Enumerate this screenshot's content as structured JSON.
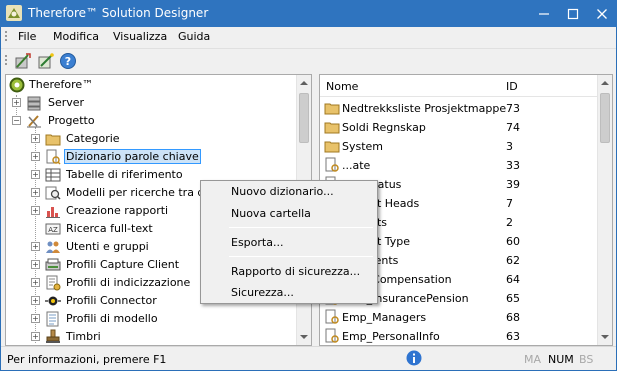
{
  "window": {
    "title": "Therefore™ Solution Designer"
  },
  "menubar": {
    "items": [
      "File",
      "Modifica",
      "Visualizza",
      "Guida"
    ]
  },
  "toolbar": {
    "buttons": [
      "designer-icon",
      "wizard-icon",
      "help-icon"
    ]
  },
  "tree": {
    "root": "Therefore™",
    "server": "Server",
    "project": "Progetto",
    "children": [
      "Categorie",
      "Dizionario parole chiave",
      "Tabelle di riferimento",
      "Modelli per ricerche tra d",
      "Creazione rapporti",
      "Ricerca full-text",
      "Utenti e gruppi",
      "Profili Capture Client",
      "Profili di indicizzazione",
      "Profili Connector",
      "Profili di modello",
      "Timbri"
    ],
    "selected_index": 1
  },
  "list": {
    "columns": {
      "name": "Nome",
      "id": "ID"
    },
    "rows": [
      {
        "name": "Nedtrekksliste Prosjektmappe",
        "id": "73",
        "icon": "folder"
      },
      {
        "name": "Soldi Regnskap",
        "id": "74",
        "icon": "folder"
      },
      {
        "name": "System",
        "id": "3",
        "icon": "folder"
      },
      {
        "name": "...ate",
        "id": "33",
        "icon": "dictionary"
      },
      {
        "name": "...ct Status",
        "id": "39",
        "icon": "dictionary"
      },
      {
        "name": "...ment Heads",
        "id": "7",
        "icon": "dictionary"
      },
      {
        "name": "...ments",
        "id": "2",
        "icon": "dictionary"
      },
      {
        "name": "...ment Type",
        "id": "60",
        "icon": "dictionary"
      },
      {
        "name": "...ccidents",
        "id": "62",
        "icon": "dictionary"
      },
      {
        "name": "Emp_Compensation",
        "id": "64",
        "icon": "dictionary"
      },
      {
        "name": "Emp_InsurancePension",
        "id": "65",
        "icon": "dictionary"
      },
      {
        "name": "Emp_Managers",
        "id": "68",
        "icon": "dictionary"
      },
      {
        "name": "Emp_PersonalInfo",
        "id": "63",
        "icon": "dictionary"
      }
    ]
  },
  "context_menu": {
    "items": [
      "Nuovo dizionario...",
      "Nuova cartella",
      "Esporta...",
      "Rapporto di sicurezza...",
      "Sicurezza..."
    ]
  },
  "statusbar": {
    "text": "Per informazioni, premere F1",
    "indicators": [
      {
        "label": "MA",
        "active": false
      },
      {
        "label": "NUM",
        "active": true
      },
      {
        "label": "BS",
        "active": false
      }
    ]
  },
  "colors": {
    "titlebar": "#2f74bf",
    "selection": "#cde3f7",
    "selection_border": "#3399ff"
  }
}
